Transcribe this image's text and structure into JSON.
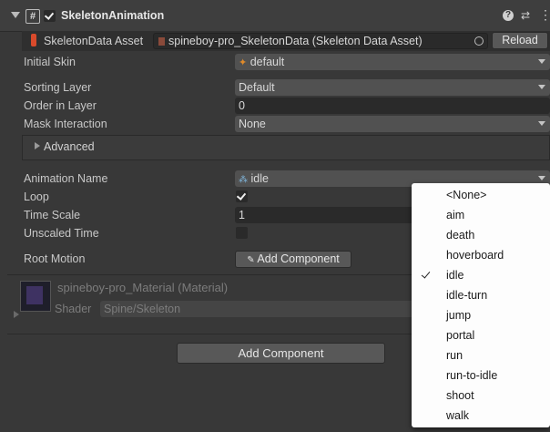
{
  "component": {
    "title": "SkeletonAnimation",
    "script_icon": "#",
    "enabled": true
  },
  "skeleton_data": {
    "label": "SkeletonData Asset",
    "value": "spineboy-pro_SkeletonData (Skeleton Data Asset)",
    "reload_label": "Reload"
  },
  "fields": {
    "initial_skin_label": "Initial Skin",
    "initial_skin_value": "default",
    "sorting_layer_label": "Sorting Layer",
    "sorting_layer_value": "Default",
    "order_label": "Order in Layer",
    "order_value": "0",
    "mask_label": "Mask Interaction",
    "mask_value": "None",
    "advanced_label": "Advanced",
    "animation_label": "Animation Name",
    "animation_value": "idle",
    "loop_label": "Loop",
    "loop_checked": true,
    "timescale_label": "Time Scale",
    "timescale_value": "1",
    "unscaled_label": "Unscaled Time",
    "unscaled_checked": false,
    "root_motion_label": "Root Motion",
    "add_component_small": "Add Component"
  },
  "material": {
    "name": "spineboy-pro_Material (Material)",
    "shader_label": "Shader",
    "shader_value": "Spine/Skeleton"
  },
  "footer": {
    "add_component_label": "Add Component"
  },
  "dropdown": {
    "selected": "idle",
    "items": [
      "<None>",
      "aim",
      "death",
      "hoverboard",
      "idle",
      "idle-turn",
      "jump",
      "portal",
      "run",
      "run-to-idle",
      "shoot",
      "walk"
    ]
  },
  "colors": {
    "panel": "#383838",
    "field": "#2a2a2a",
    "dropdown": "#515151",
    "menu": "#fdfdfd"
  }
}
